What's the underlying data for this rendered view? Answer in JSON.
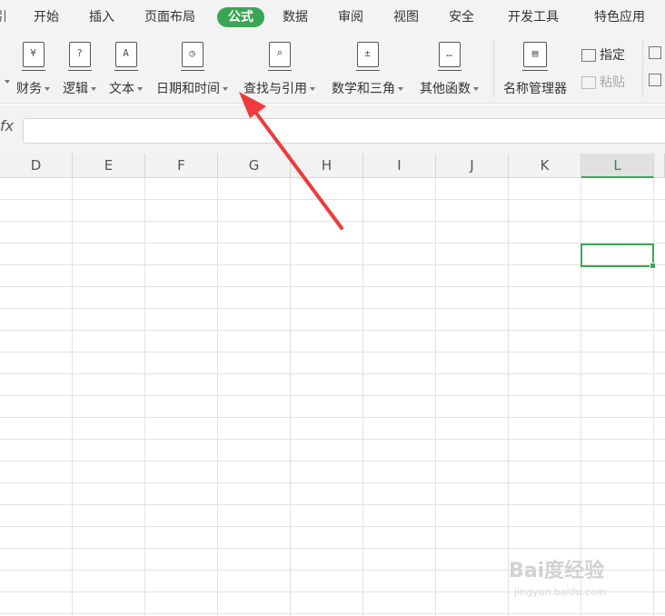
{
  "menu": {
    "partial_left": "引",
    "tabs": [
      "开始",
      "插入",
      "页面布局",
      "公式",
      "数据",
      "审阅",
      "视图",
      "安全",
      "开发工具",
      "特色应用"
    ],
    "active": "公式"
  },
  "ribbon": {
    "finance": "财务",
    "logic": "逻辑",
    "text": "文本",
    "datetime": "日期和时间",
    "lookup": "查找与引用",
    "math": "数学和三角",
    "other": "其他函数",
    "name_manager": "名称管理器",
    "specify": "指定",
    "paste": "粘贴"
  },
  "formula_bar": {
    "fx": "fx",
    "value": ""
  },
  "columns": [
    "D",
    "E",
    "F",
    "G",
    "H",
    "I",
    "J",
    "K",
    "L"
  ],
  "selected_column": "L",
  "watermark": {
    "brand": "Bai度经验",
    "url": "jingyan.baidu.com"
  },
  "colors": {
    "accent": "#3aa655",
    "arrow": "#ee3b3b"
  }
}
